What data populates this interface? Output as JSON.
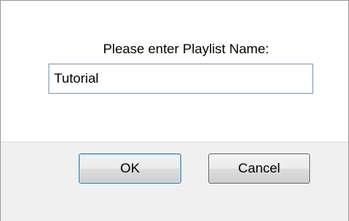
{
  "dialog": {
    "prompt": "Please enter Playlist Name:",
    "input_value": "Tutorial",
    "ok_label": "OK",
    "cancel_label": "Cancel"
  },
  "colors": {
    "footer_bg": "#f0f0f0",
    "default_button_border": "#3c7fb1"
  }
}
